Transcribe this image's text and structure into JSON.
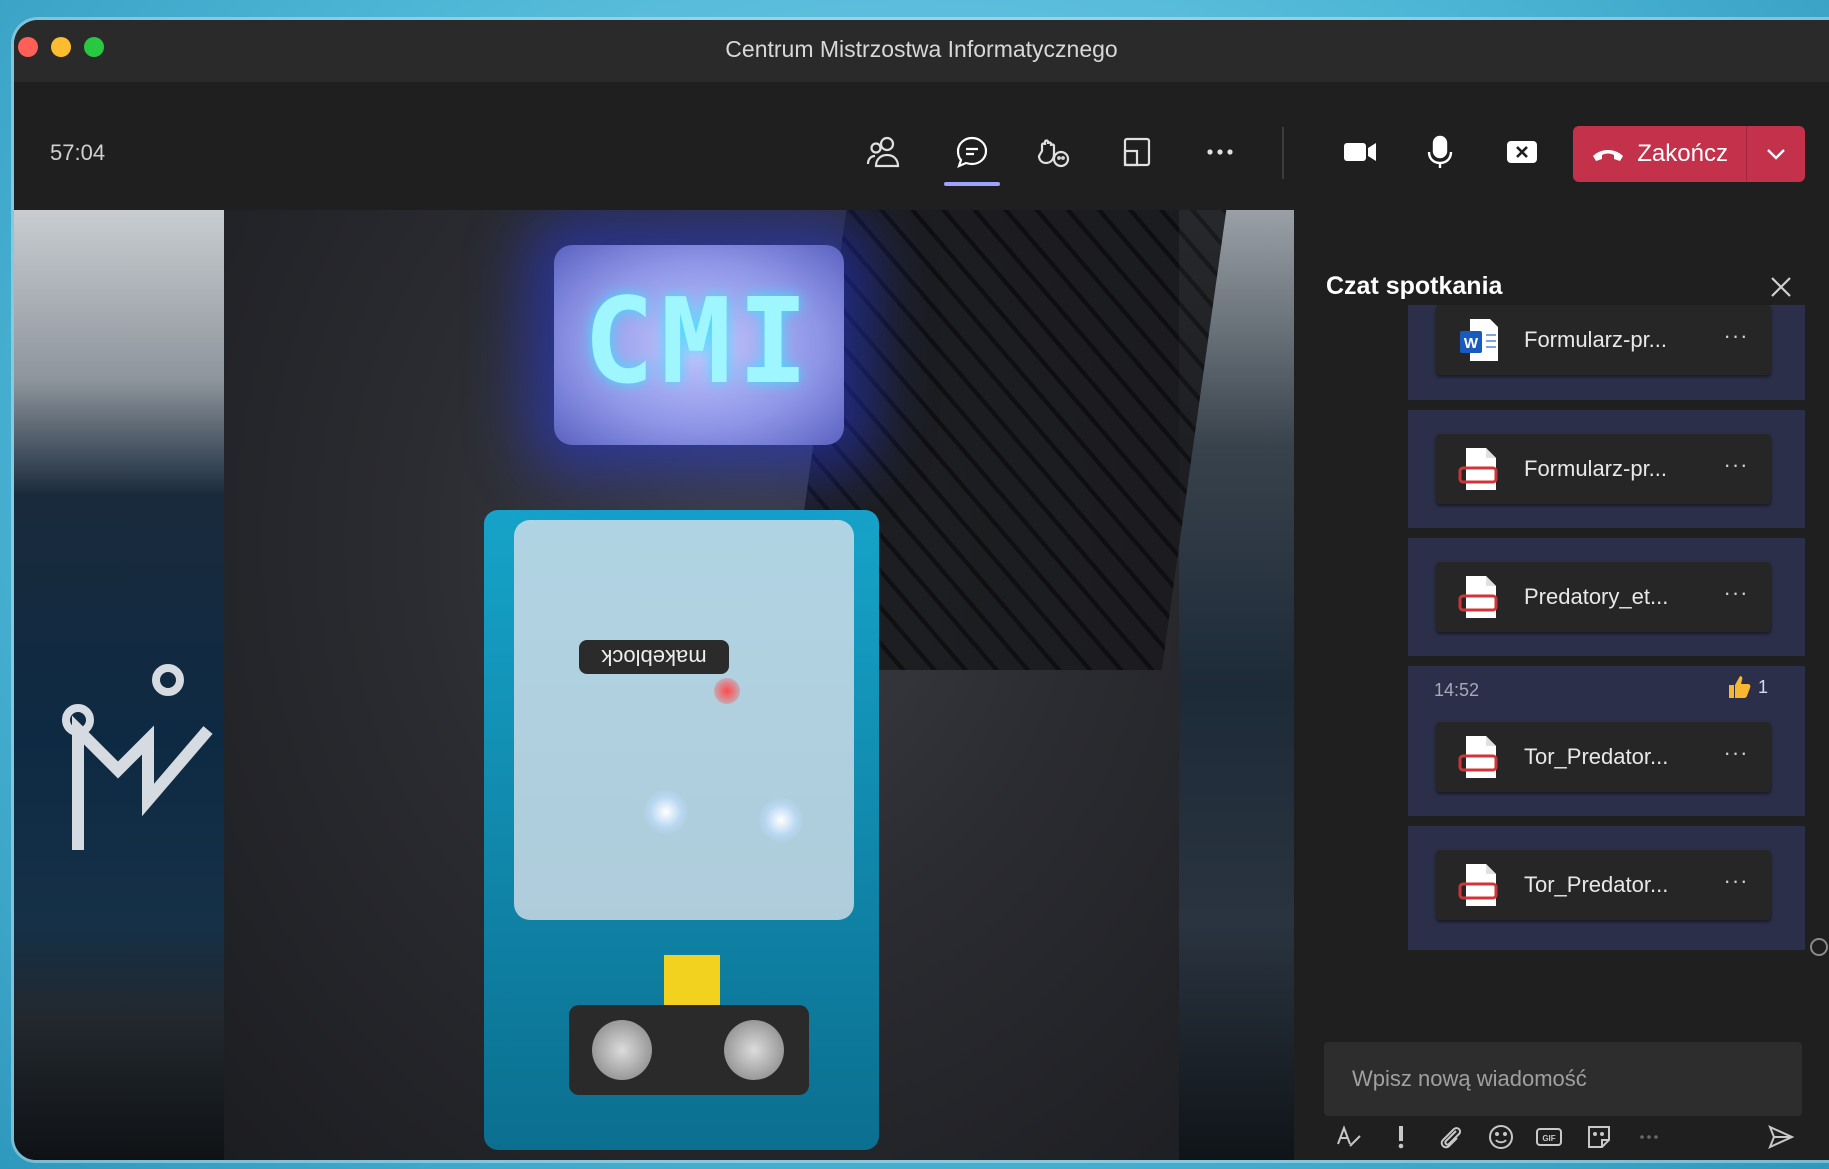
{
  "window": {
    "title": "Centrum Mistrzostwa Informatycznego"
  },
  "toolbar": {
    "timer": "57:04",
    "icons": [
      "participants-icon",
      "chat-icon",
      "reactions-icon",
      "share-tray-icon",
      "more-icon",
      "camera-icon",
      "microphone-icon",
      "stop-share-icon"
    ],
    "end_label": "Zakończ"
  },
  "video": {
    "led_text": "CMI",
    "brand_label": "makeblock"
  },
  "chat": {
    "title": "Czat spotkania",
    "files": [
      {
        "name": "Formularz-pr...",
        "icon": "word-file-icon"
      },
      {
        "name": "Formularz-pr...",
        "icon": "pdf-file-icon"
      },
      {
        "name": "Predatory_et...",
        "icon": "pdf-file-icon"
      },
      {
        "name": "Tor_Predator...",
        "icon": "pdf-file-icon"
      },
      {
        "name": "Tor_Predator...",
        "icon": "pdf-file-icon"
      }
    ],
    "message_time": "14:52",
    "reaction_count": "1",
    "more_label": "···",
    "compose_placeholder": "Wpisz nową wiadomość"
  },
  "colors": {
    "end_button": "#c4314b",
    "message_bg": "#2c2f4a",
    "accent": "#9ea2ff"
  }
}
